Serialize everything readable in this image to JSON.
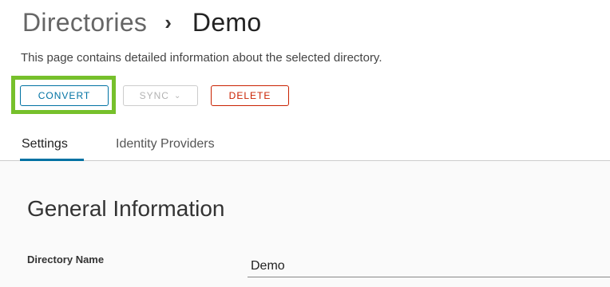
{
  "breadcrumb": {
    "parent": "Directories",
    "separator": "›",
    "current": "Demo"
  },
  "description": "This page contains detailed information about the selected directory.",
  "actions": {
    "convert_label": "CONVERT",
    "sync_label": "SYNC",
    "sync_chevron": "⌄",
    "delete_label": "DELETE"
  },
  "tabs": [
    {
      "label": "Settings",
      "active": true
    },
    {
      "label": "Identity Providers",
      "active": false
    }
  ],
  "general": {
    "title": "General Information",
    "fields": [
      {
        "label": "Directory Name",
        "value": "Demo"
      }
    ]
  },
  "colors": {
    "primary": "#0072a3",
    "danger": "#c92100",
    "disabled": "#b3b3b3",
    "highlight": "#76c02b"
  }
}
